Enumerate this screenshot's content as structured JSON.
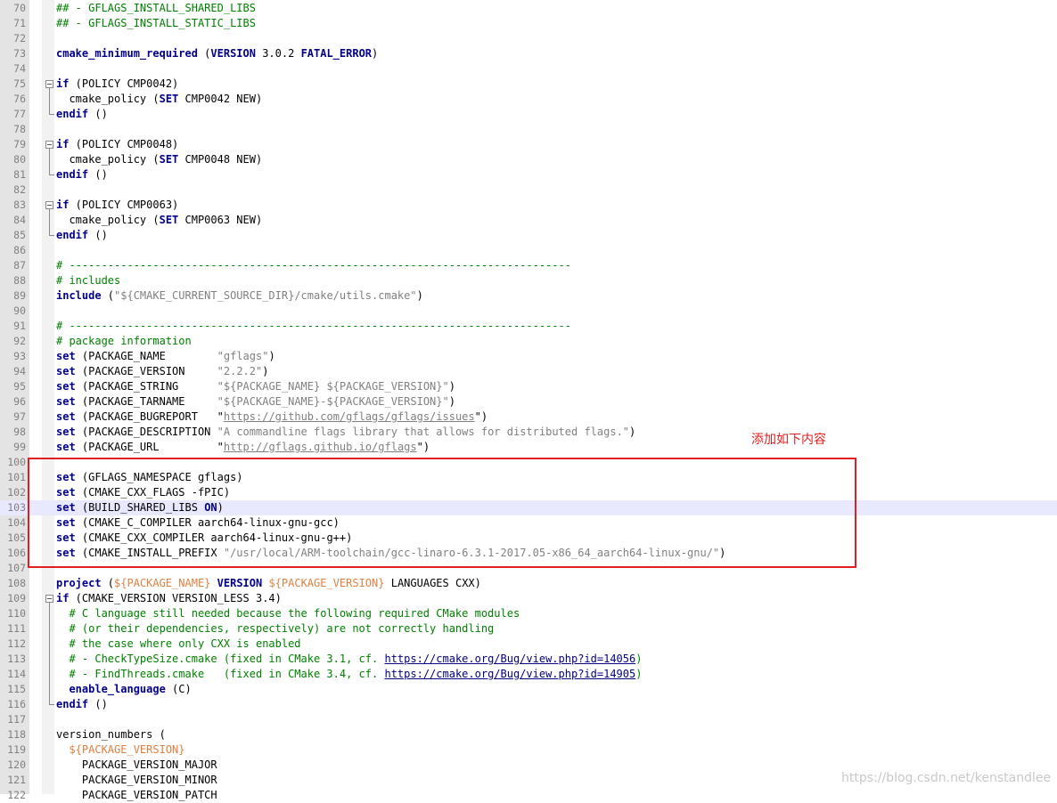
{
  "annotation": "添加如下内容",
  "watermark": "https://blog.csdn.net/kenstandlee",
  "lines": [
    {
      "n": "70",
      "t": [
        [
          "## - GFLAGS_INSTALL_SHARED_LIBS",
          "cm"
        ]
      ]
    },
    {
      "n": "71",
      "t": [
        [
          "## - GFLAGS_INSTALL_STATIC_LIBS",
          "cm"
        ]
      ]
    },
    {
      "n": "72",
      "t": []
    },
    {
      "n": "73",
      "t": [
        [
          "cmake_minimum_required",
          "kw"
        ],
        [
          " (",
          ""
        ],
        [
          "VERSION",
          "kw"
        ],
        [
          " 3.0.2 ",
          ""
        ],
        [
          "FATAL_ERROR",
          "kw"
        ],
        [
          ")",
          ""
        ]
      ]
    },
    {
      "n": "74",
      "t": []
    },
    {
      "n": "75",
      "fold": "open",
      "t": [
        [
          "if",
          "kw"
        ],
        [
          " (POLICY CMP0042)",
          ""
        ]
      ]
    },
    {
      "n": "76",
      "fold": "mid",
      "t": [
        [
          "  cmake_policy (",
          ""
        ],
        [
          "SET",
          "kw"
        ],
        [
          " CMP0042 NEW)",
          ""
        ]
      ]
    },
    {
      "n": "77",
      "fold": "end",
      "t": [
        [
          "endif",
          "kw"
        ],
        [
          " ()",
          ""
        ]
      ]
    },
    {
      "n": "78",
      "t": []
    },
    {
      "n": "79",
      "fold": "open",
      "t": [
        [
          "if",
          "kw"
        ],
        [
          " (POLICY CMP0048)",
          ""
        ]
      ]
    },
    {
      "n": "80",
      "fold": "mid",
      "t": [
        [
          "  cmake_policy (",
          ""
        ],
        [
          "SET",
          "kw"
        ],
        [
          " CMP0048 NEW)",
          ""
        ]
      ]
    },
    {
      "n": "81",
      "fold": "end",
      "t": [
        [
          "endif",
          "kw"
        ],
        [
          " ()",
          ""
        ]
      ]
    },
    {
      "n": "82",
      "t": []
    },
    {
      "n": "83",
      "fold": "open",
      "t": [
        [
          "if",
          "kw"
        ],
        [
          " (POLICY CMP0063)",
          ""
        ]
      ]
    },
    {
      "n": "84",
      "fold": "mid",
      "t": [
        [
          "  cmake_policy (",
          ""
        ],
        [
          "SET",
          "kw"
        ],
        [
          " CMP0063 NEW)",
          ""
        ]
      ]
    },
    {
      "n": "85",
      "fold": "end",
      "t": [
        [
          "endif",
          "kw"
        ],
        [
          " ()",
          ""
        ]
      ]
    },
    {
      "n": "86",
      "t": []
    },
    {
      "n": "87",
      "t": [
        [
          "# ------------------------------------------------------------------------------",
          "cm"
        ]
      ]
    },
    {
      "n": "88",
      "t": [
        [
          "# includes",
          "cm"
        ]
      ]
    },
    {
      "n": "89",
      "t": [
        [
          "include",
          "kw"
        ],
        [
          " (",
          ""
        ],
        [
          "\"${CMAKE_CURRENT_SOURCE_DIR}/cmake/utils.cmake\"",
          "str"
        ],
        [
          ")",
          ""
        ]
      ]
    },
    {
      "n": "90",
      "t": []
    },
    {
      "n": "91",
      "t": [
        [
          "# ------------------------------------------------------------------------------",
          "cm"
        ]
      ]
    },
    {
      "n": "92",
      "t": [
        [
          "# package information",
          "cm"
        ]
      ]
    },
    {
      "n": "93",
      "t": [
        [
          "set",
          "kw"
        ],
        [
          " (PACKAGE_NAME        ",
          ""
        ],
        [
          "\"gflags\"",
          "str"
        ],
        [
          ")",
          ""
        ]
      ]
    },
    {
      "n": "94",
      "t": [
        [
          "set",
          "kw"
        ],
        [
          " (PACKAGE_VERSION     ",
          ""
        ],
        [
          "\"2.2.2\"",
          "str"
        ],
        [
          ")",
          ""
        ]
      ]
    },
    {
      "n": "95",
      "t": [
        [
          "set",
          "kw"
        ],
        [
          " (PACKAGE_STRING      ",
          ""
        ],
        [
          "\"${PACKAGE_NAME} ${PACKAGE_VERSION}\"",
          "str"
        ],
        [
          ")",
          ""
        ]
      ]
    },
    {
      "n": "96",
      "t": [
        [
          "set",
          "kw"
        ],
        [
          " (PACKAGE_TARNAME     ",
          ""
        ],
        [
          "\"${PACKAGE_NAME}-${PACKAGE_VERSION}\"",
          "str"
        ],
        [
          ")",
          ""
        ]
      ]
    },
    {
      "n": "97",
      "t": [
        [
          "set",
          "kw"
        ],
        [
          " (PACKAGE_BUGREPORT   ",
          ""
        ],
        [
          "\"",
          ""
        ],
        [
          "https://github.com/gflags/gflags/issues",
          "url"
        ],
        [
          "\"",
          ""
        ],
        [
          ")",
          ""
        ]
      ]
    },
    {
      "n": "98",
      "t": [
        [
          "set",
          "kw"
        ],
        [
          " (PACKAGE_DESCRIPTION ",
          ""
        ],
        [
          "\"A commandline flags library that allows for distributed flags.\"",
          "str"
        ],
        [
          ")",
          ""
        ]
      ]
    },
    {
      "n": "99",
      "t": [
        [
          "set",
          "kw"
        ],
        [
          " (PACKAGE_URL         ",
          ""
        ],
        [
          "\"",
          ""
        ],
        [
          "http://gflags.github.io/gflags",
          "url"
        ],
        [
          "\"",
          ""
        ],
        [
          ")",
          ""
        ]
      ]
    },
    {
      "n": "100",
      "t": []
    },
    {
      "n": "101",
      "t": [
        [
          "set",
          "kw"
        ],
        [
          " (GFLAGS_NAMESPACE gflags)",
          ""
        ]
      ]
    },
    {
      "n": "102",
      "t": [
        [
          "set",
          "kw"
        ],
        [
          " (CMAKE_CXX_FLAGS -fPIC)",
          ""
        ]
      ]
    },
    {
      "n": "103",
      "current": true,
      "t": [
        [
          "set",
          "kw"
        ],
        [
          " (BUILD_SHARED_LIBS ",
          ""
        ],
        [
          "ON",
          "kw"
        ],
        [
          ")",
          ""
        ]
      ]
    },
    {
      "n": "104",
      "t": [
        [
          "set",
          "kw"
        ],
        [
          " (CMAKE_C_COMPILER aarch64-linux-gnu-gcc)",
          ""
        ]
      ]
    },
    {
      "n": "105",
      "t": [
        [
          "set",
          "kw"
        ],
        [
          " (CMAKE_CXX_COMPILER aarch64-linux-gnu-g++)",
          ""
        ]
      ]
    },
    {
      "n": "106",
      "t": [
        [
          "set",
          "kw"
        ],
        [
          " (CMAKE_INSTALL_PREFIX ",
          ""
        ],
        [
          "\"/usr/local/ARM-toolchain/gcc-linaro-6.3.1-2017.05-x86_64_aarch64-linux-gnu/\"",
          "str"
        ],
        [
          ")",
          ""
        ]
      ]
    },
    {
      "n": "107",
      "t": []
    },
    {
      "n": "108",
      "t": [
        [
          "project",
          "kw"
        ],
        [
          " (",
          ""
        ],
        [
          "${PACKAGE_NAME}",
          "var"
        ],
        [
          " ",
          ""
        ],
        [
          "VERSION",
          "kw"
        ],
        [
          " ",
          ""
        ],
        [
          "${PACKAGE_VERSION}",
          "var"
        ],
        [
          " LANGUAGES CXX)",
          ""
        ]
      ]
    },
    {
      "n": "109",
      "fold": "open",
      "t": [
        [
          "if",
          "kw"
        ],
        [
          " (CMAKE_VERSION VERSION_LESS 3.4)",
          ""
        ]
      ]
    },
    {
      "n": "110",
      "fold": "mid",
      "t": [
        [
          "  # C language still needed because the following required CMake modules",
          "cm"
        ]
      ]
    },
    {
      "n": "111",
      "fold": "mid",
      "t": [
        [
          "  # (or their dependencies, respectively) are not correctly handling",
          "cm"
        ]
      ]
    },
    {
      "n": "112",
      "fold": "mid",
      "t": [
        [
          "  # the case where only CXX is enabled",
          "cm"
        ]
      ]
    },
    {
      "n": "113",
      "fold": "mid",
      "t": [
        [
          "  # - CheckTypeSize.cmake (fixed in CMake 3.1, cf. ",
          "cm"
        ],
        [
          "https://cmake.org/Bug/view.php?id=14056",
          "url2"
        ],
        [
          ")",
          "cm"
        ]
      ]
    },
    {
      "n": "114",
      "fold": "mid",
      "t": [
        [
          "  # - FindThreads.cmake   (fixed in CMake 3.4, cf. ",
          "cm"
        ],
        [
          "https://cmake.org/Bug/view.php?id=14905",
          "url2"
        ],
        [
          ")",
          "cm"
        ]
      ]
    },
    {
      "n": "115",
      "fold": "mid",
      "t": [
        [
          "  ",
          ""
        ],
        [
          "enable_language",
          "kw"
        ],
        [
          " (C)",
          ""
        ]
      ]
    },
    {
      "n": "116",
      "fold": "end",
      "t": [
        [
          "endif",
          "kw"
        ],
        [
          " ()",
          ""
        ]
      ]
    },
    {
      "n": "117",
      "t": []
    },
    {
      "n": "118",
      "t": [
        [
          "version_numbers (",
          ""
        ]
      ]
    },
    {
      "n": "119",
      "t": [
        [
          "  ",
          ""
        ],
        [
          "${PACKAGE_VERSION}",
          "var"
        ]
      ]
    },
    {
      "n": "120",
      "t": [
        [
          "    PACKAGE_VERSION_MAJOR",
          ""
        ]
      ]
    },
    {
      "n": "121",
      "t": [
        [
          "    PACKAGE_VERSION_MINOR",
          ""
        ]
      ]
    },
    {
      "n": "122",
      "t": [
        [
          "    PACKAGE_VERSION_PATCH",
          ""
        ]
      ]
    }
  ]
}
